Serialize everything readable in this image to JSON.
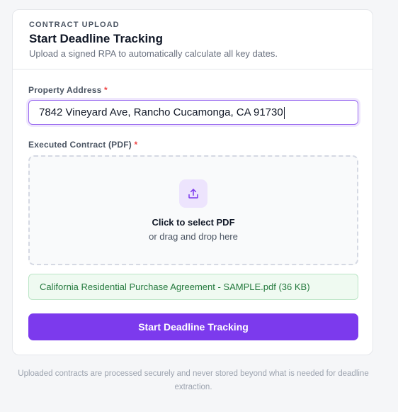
{
  "header": {
    "eyebrow": "CONTRACT UPLOAD",
    "title": "Start Deadline Tracking",
    "subtitle": "Upload a signed RPA to automatically calculate all key dates."
  },
  "property": {
    "label": "Property Address",
    "required_mark": "*",
    "value": "7842 Vineyard Ave, Rancho Cucamonga, CA 91730"
  },
  "contract": {
    "label": "Executed Contract (PDF)",
    "required_mark": "*",
    "dropzone_icon": "upload-icon",
    "dropzone_title": "Click to select PDF",
    "dropzone_sub": "or drag and drop here",
    "selected_file": "California Residential Purchase Agreement - SAMPLE.pdf (36 KB)"
  },
  "submit": {
    "label": "Start Deadline Tracking"
  },
  "footnote": "Uploaded contracts are processed securely and never stored beyond what is needed for deadline extraction.",
  "colors": {
    "accent": "#7c3aed",
    "required": "#ef4444",
    "success_text": "#257a3e",
    "success_bg": "#effaf1"
  }
}
